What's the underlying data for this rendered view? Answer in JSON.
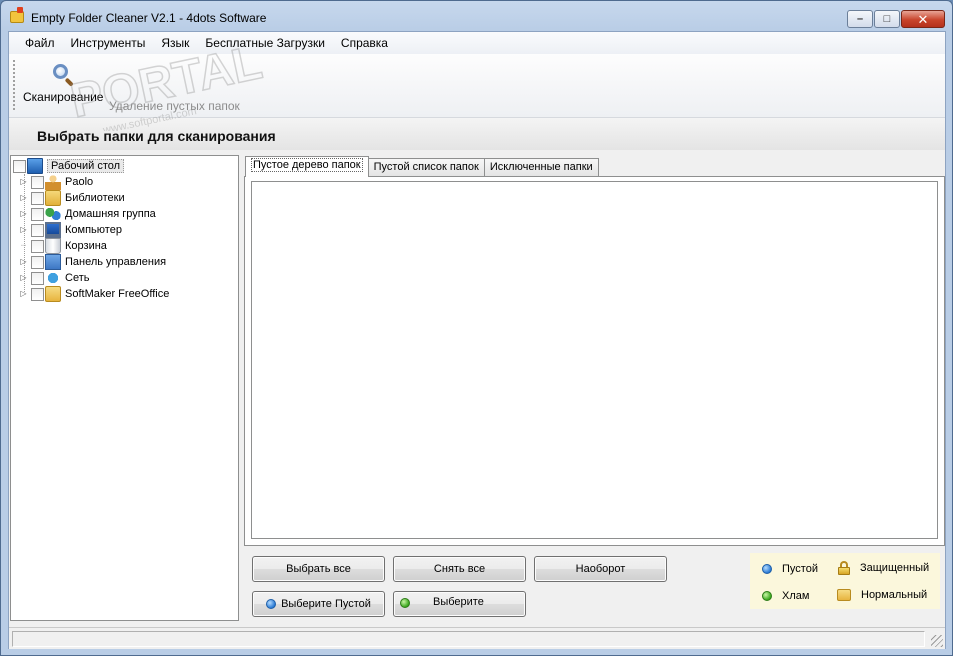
{
  "window": {
    "title": "Empty Folder Cleaner V2.1 - 4dots Software",
    "minimize_glyph": "–",
    "maximize_glyph": "□",
    "close_glyph": "✕"
  },
  "menu": [
    "Файл",
    "Инструменты",
    "Язык",
    "Бесплатные Загрузки",
    "Справка"
  ],
  "toolbar": {
    "scan_label": "Сканирование",
    "delete_label": "Удаление пустых папок"
  },
  "section_title": "Выбрать папки для сканирования",
  "tree": {
    "root": "Рабочий стол",
    "items": [
      {
        "label": "Paolo",
        "icon": "user-folder-icon"
      },
      {
        "label": "Библиотеки",
        "icon": "libraries-icon"
      },
      {
        "label": "Домашняя группа",
        "icon": "homegroup-icon"
      },
      {
        "label": "Компьютер",
        "icon": "computer-icon"
      },
      {
        "label": "Корзина",
        "icon": "recycle-bin-icon"
      },
      {
        "label": "Панель управления",
        "icon": "control-panel-icon"
      },
      {
        "label": "Сеть",
        "icon": "network-icon"
      },
      {
        "label": "SoftMaker FreeOffice",
        "icon": "folder-icon"
      }
    ]
  },
  "tabs": [
    "Пустое дерево папок",
    "Пустой список папок",
    "Исключенные папки"
  ],
  "buttons": {
    "select_all": "Выбрать все",
    "deselect_all": "Снять все",
    "invert": "Наоборот",
    "select_empty": "Выберите Пустой",
    "select": "Выберите"
  },
  "legend": {
    "empty": "Пустой",
    "protected": "Защищенный",
    "junk": "Хлам",
    "normal": "Нормальный"
  },
  "colors": {
    "empty_dot": "#2a7ad4",
    "junk_dot": "#3aa71d"
  },
  "watermark": {
    "text": "PORTAL",
    "url": "www.softportal.com"
  }
}
